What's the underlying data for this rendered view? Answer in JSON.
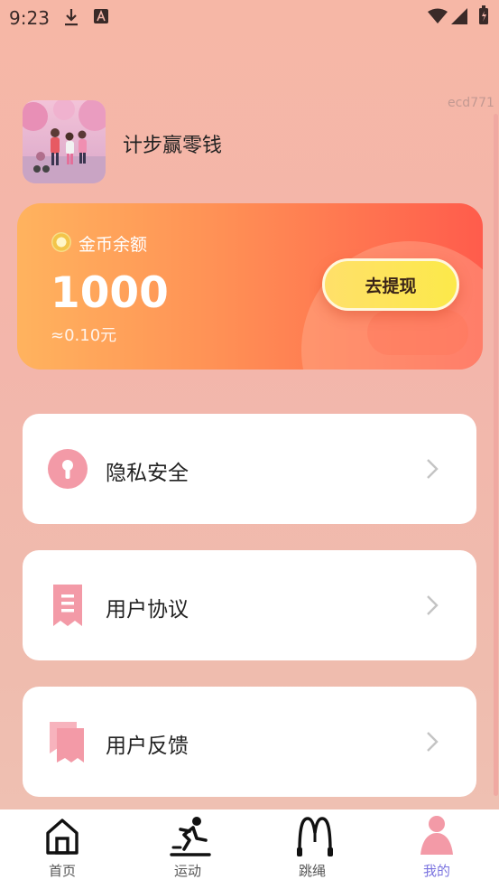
{
  "status_bar": {
    "time": "9:23"
  },
  "watermark": "ecd771",
  "profile": {
    "app_name": "计步赢零钱"
  },
  "coin_card": {
    "label": "金币余额",
    "amount": "1000",
    "approx_value": "≈0.10元",
    "withdraw_button": "去提现"
  },
  "menu": [
    {
      "label": "隐私安全",
      "icon": "lock-icon"
    },
    {
      "label": "用户协议",
      "icon": "document-icon"
    },
    {
      "label": "用户反馈",
      "icon": "feedback-icon"
    }
  ],
  "bottom_nav": {
    "items": [
      {
        "label": "首页",
        "icon": "home-icon"
      },
      {
        "label": "运动",
        "icon": "running-icon"
      },
      {
        "label": "跳绳",
        "icon": "jump-rope-icon"
      },
      {
        "label": "我的",
        "icon": "profile-icon"
      }
    ],
    "active_index": 3,
    "active_color": "#7b74e0"
  },
  "colors": {
    "accent": "#f39aa7",
    "card_start": "#ffb35e",
    "card_end": "#ff5c4c",
    "button": "#fce94a"
  }
}
